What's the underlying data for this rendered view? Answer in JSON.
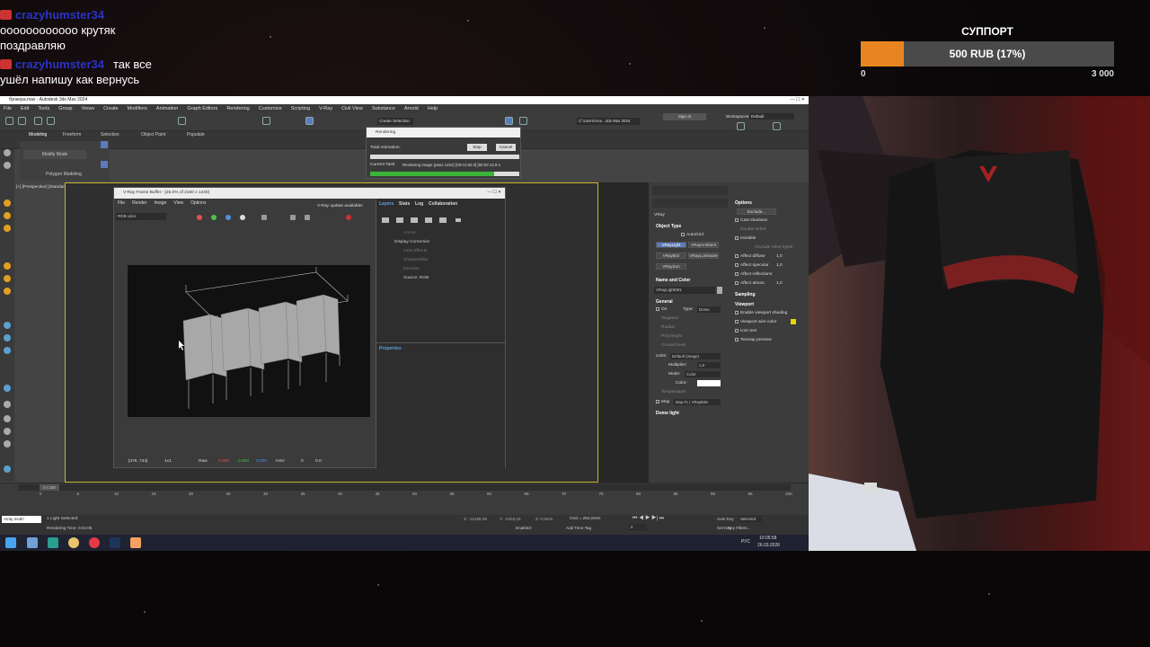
{
  "chat": [
    {
      "user": "crazyhumster34",
      "text": ""
    },
    {
      "user": "",
      "text": "оооооооооооо крутяк"
    },
    {
      "user": "",
      "text": "поздравляю"
    },
    {
      "user": "crazyhumster34",
      "text": "так все"
    },
    {
      "user": "",
      "text": "ушёл напишу как вернусь"
    }
  ],
  "support": {
    "title": "СУППОРТ",
    "label": "500 RUB (17%)",
    "progress": 0.17,
    "min": "0",
    "max": "3 000",
    "fill_color": "#e98520"
  },
  "max": {
    "window_title": "бункера.max - Autodesk 3ds Max 2024",
    "menu": [
      "File",
      "Edit",
      "Tools",
      "Group",
      "Views",
      "Create",
      "Modifiers",
      "Animation",
      "Graph Editors",
      "Rendering",
      "Customize",
      "Scripting",
      "V-Ray",
      "Civil View",
      "Substance",
      "Arnold",
      "Help"
    ],
    "sign_in": "Sign In",
    "workspaces": "Workspaces:",
    "workspace": "Default",
    "project_path": "C:\\Users\\Ane...3ds Max 2024",
    "selection_set": "Create Selection Se",
    "ribbon_tabs": [
      "Modeling",
      "Freeform",
      "Selection",
      "Object Paint",
      "Populate"
    ],
    "modify_mode": "Modify Mode",
    "poly_modeling": "Polygon Modeling",
    "viewport_label": "[+] [Perspective] [Standard] [Default Shading]",
    "rendering": {
      "title": "Rendering",
      "total_animation": "Total Animation:",
      "stop": "Stop",
      "cancel": "Cancel",
      "current_task_label": "Current Task:",
      "current_task": "Rendering image (pass 1452) [00:01:50.0] [00:02:12.8 e",
      "progress": 0.83
    },
    "vfb": {
      "title": "V-Ray Frame Buffer - [25.0% of 2160 x 1440]",
      "update": "V-Ray update available!",
      "menu": [
        "File",
        "Render",
        "Image",
        "View",
        "Options"
      ],
      "channel": "RGB color",
      "tabs": [
        "Layers",
        "Stats",
        "Log",
        "Collaboration"
      ],
      "layers": [
        "Stamp",
        "Display Correction",
        "Lens Effects",
        "Sharpen/Blur",
        "Denoise",
        "Source: RGB"
      ],
      "properties": "Properties",
      "coords": "[476, 744]",
      "zoom": "1x1",
      "raw": "Raw",
      "r": "0.000",
      "g": "0.000",
      "b": "0.000",
      "mode": "HSV",
      "v1": "0",
      "v2": "0.0"
    },
    "cmd": {
      "vray": "VRay",
      "object_type": "Object Type",
      "autogrid": "AutoGrid",
      "buttons": [
        "VRayLight",
        "VRayAmbient",
        "VRayIES",
        "VRayLuminaire",
        "VRaySun"
      ],
      "name_color": "Name and Color",
      "name": "VRayLight001",
      "general": "General",
      "on": "On",
      "type_label": "Type:",
      "type_value": "Dome",
      "targeted": "Targeted",
      "radius": "Radius",
      "proj_height": "Proj height",
      "ground_level": "Ground level",
      "units": "Units:",
      "units_value": "Default (image)",
      "multiplier": "Multiplier:",
      "multiplier_value": "1,0",
      "mode": "Mode:",
      "mode_value": "Color",
      "color": "Color:",
      "temperature": "Temperature:",
      "map": "Map",
      "map_value": "Map #1 ( VRayBitm",
      "dome_light": "Dome light",
      "options": "Options",
      "exclude": "Exclude...",
      "cast_shadows": "Cast shadows",
      "double_sided": "Double-sided",
      "invisible": "Invisible",
      "occlude": "Occlude other lights",
      "affect_diffuse": "Affect diffuse",
      "affect_specular": "Affect specular",
      "affect_reflections": "Affect reflections",
      "affect_atmos": "Affect atmos.",
      "val_10": "1,0",
      "sampling": "Sampling",
      "viewport": "Viewport",
      "enable_shading": "Enable viewport shading",
      "wire_color": "Viewport wire color",
      "icon_text": "Icon text",
      "texmap_preview": "Texmap preview",
      "wire_swatch": "#e8d800"
    },
    "timeline": {
      "frame": "0 / 100",
      "ticks": [
        "0",
        "5",
        "10",
        "15",
        "20",
        "25",
        "30",
        "35",
        "40",
        "45",
        "50",
        "55",
        "60",
        "65",
        "70",
        "75",
        "80",
        "85",
        "90",
        "95",
        "100"
      ]
    },
    "status": {
      "script_box": "Array mod!!",
      "selected": "1 Light Selected",
      "render_time": "Rendering Time: 0:04:05",
      "x_label": "X:",
      "x": "-11298,09",
      "y_label": "Y:",
      "y": "-2203,16",
      "z_label": "Z:",
      "z": "0,0mm",
      "grid": "Grid = 254,0mm",
      "enabled": "Enabled:",
      "add_time_tag": "Add Time Tag",
      "auto_key": "Auto Key",
      "selected_filter": "Selected",
      "set_key": "Set Key",
      "key_filters": "Key Filters...",
      "frame_box": "0"
    },
    "taskbar": {
      "lang": "РУС",
      "time": "10:05:58",
      "date": "26.03.2026"
    }
  }
}
